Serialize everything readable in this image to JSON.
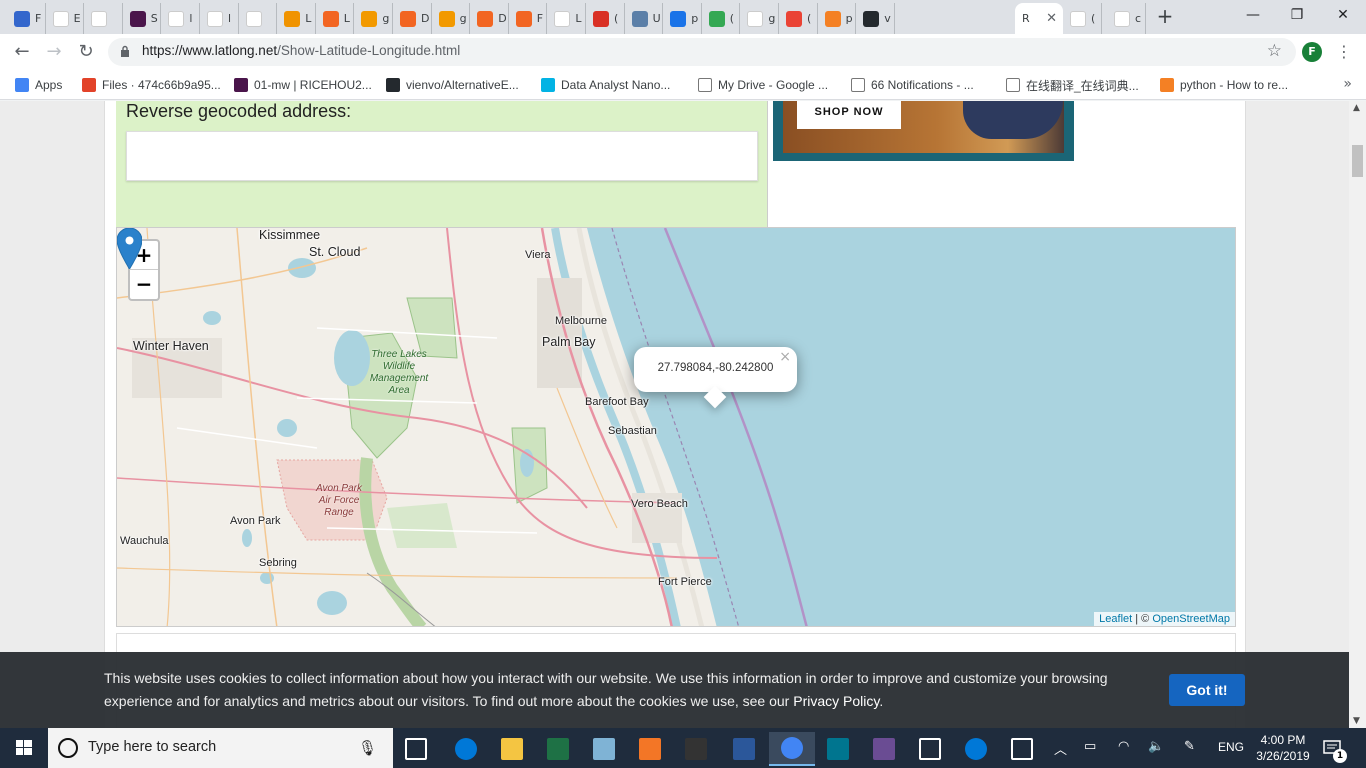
{
  "browser": {
    "tabs": [
      {
        "label": "F",
        "icon": "wikimedia-icon",
        "color": "#3366cc"
      },
      {
        "label": "E",
        "icon": "wikipedia-icon",
        "color": "#ffffff"
      },
      {
        "label": "",
        "icon": "cia-icon",
        "color": "#ffffff"
      },
      {
        "label": "S",
        "icon": "slack-icon",
        "color": "#4a154b"
      },
      {
        "label": "l",
        "icon": "k-icon",
        "color": "#ffffff"
      },
      {
        "label": "l",
        "icon": "k-icon",
        "color": "#ffffff"
      },
      {
        "label": "",
        "icon": "speaker-icon",
        "color": "#ffffff"
      },
      {
        "label": "L",
        "icon": "book-icon",
        "color": "#f09300"
      },
      {
        "label": "L",
        "icon": "circle-orange-icon",
        "color": "#f26522"
      },
      {
        "label": "g",
        "icon": "doc-orange-icon",
        "color": "#f29900"
      },
      {
        "label": "D",
        "icon": "circle-orange-icon",
        "color": "#f26522"
      },
      {
        "label": "g",
        "icon": "doc-orange-icon",
        "color": "#f29900"
      },
      {
        "label": "D",
        "icon": "circle-orange-icon",
        "color": "#f26522"
      },
      {
        "label": "F",
        "icon": "circle-orange-icon",
        "color": "#f26522"
      },
      {
        "label": "L",
        "icon": "wikipedia-icon",
        "color": "#ffffff"
      },
      {
        "label": "(",
        "icon": "gmail-icon",
        "color": "#d93025"
      },
      {
        "label": "U",
        "icon": "grid-icon",
        "color": "#5b7fa8"
      },
      {
        "label": "p",
        "icon": "chart-icon",
        "color": "#1a73e8"
      },
      {
        "label": "(",
        "icon": "maps-icon",
        "color": "#34a853"
      },
      {
        "label": "g",
        "icon": "google-icon",
        "color": "#ffffff"
      },
      {
        "label": "(",
        "icon": "red-square-icon",
        "color": "#ea4335"
      },
      {
        "label": "p",
        "icon": "stackoverflow-icon",
        "color": "#f48024"
      },
      {
        "label": "v",
        "icon": "github-icon",
        "color": "#24292e"
      },
      {
        "label": "R",
        "icon": "none",
        "color": "#ffffff",
        "active": true
      },
      {
        "label": "(",
        "icon": "wikipedia-icon",
        "color": "#ffffff"
      },
      {
        "label": "c",
        "icon": "google-icon",
        "color": "#ffffff"
      }
    ],
    "url_host": "https://www.latlong.net",
    "url_path": "/Show-Latitude-Longitude.html",
    "profile_initial": "F",
    "bookmarks": [
      {
        "label": "Apps",
        "icon": "apps-icon",
        "color": "#4285f4"
      },
      {
        "label": "Files · 474c66b9a95...",
        "icon": "gitlab-icon",
        "color": "#e24329"
      },
      {
        "label": "01-mw | RICEHOU2...",
        "icon": "slack-icon",
        "color": "#4a154b"
      },
      {
        "label": "vienvo/AlternativeE...",
        "icon": "github-icon",
        "color": "#24292e"
      },
      {
        "label": "Data Analyst Nano...",
        "icon": "udacity-icon",
        "color": "#02b3e4"
      },
      {
        "label": "My Drive - Google ...",
        "icon": "page-icon",
        "color": "#ffffff"
      },
      {
        "label": "66 Notifications - ...",
        "icon": "page-icon",
        "color": "#ffffff"
      },
      {
        "label": "在线翻译_在线词典...",
        "icon": "page-icon",
        "color": "#ffffff"
      },
      {
        "label": "python - How to re...",
        "icon": "stackoverflow-icon",
        "color": "#f48024"
      }
    ]
  },
  "page": {
    "reverse_label": "Reverse geocoded address:",
    "reverse_value": "",
    "ad_button": "SHOP NOW"
  },
  "map": {
    "cities": [
      {
        "name": "Kissimmee",
        "big": true
      },
      {
        "name": "St. Cloud",
        "big": true
      },
      {
        "name": "Viera",
        "big": false
      },
      {
        "name": "Melbourne",
        "big": false
      },
      {
        "name": "Palm Bay",
        "big": true
      },
      {
        "name": "Winter Haven",
        "big": true
      },
      {
        "name": "Barefoot Bay",
        "big": false
      },
      {
        "name": "Sebastian",
        "big": false
      },
      {
        "name": "Vero Beach",
        "big": false
      },
      {
        "name": "Avon Park",
        "big": false
      },
      {
        "name": "Wauchula",
        "big": false
      },
      {
        "name": "Sebring",
        "big": false
      },
      {
        "name": "Fort Pierce",
        "big": false
      }
    ],
    "parks": [
      {
        "name": "Three Lakes Wildlife Management Area"
      },
      {
        "name": "Avon Park Air Force Range"
      }
    ],
    "popup_text": "27.798084,-80.242800",
    "zoom_in": "+",
    "zoom_out": "−",
    "attribution_leaflet": "Leaflet",
    "attribution_sep": " | © ",
    "attribution_osm": "OpenStreetMap",
    "colors": {
      "water": "#aad3df",
      "land": "#f2efe9",
      "park": "#c8dfb3",
      "marker": "#2a81cb"
    }
  },
  "cookie": {
    "text": "This website uses cookies to collect information about how you interact with our website. We use this information in order to improve and customize your browsing experience and for analytics and metrics about our visitors. To find out more about the cookies we use, see our ",
    "policy_link": "Privacy Policy",
    "policy_end": ".",
    "button": "Got it!"
  },
  "taskbar": {
    "search_placeholder": "Type here to search",
    "apps": [
      {
        "icon": "task-view-icon",
        "color": "#ffffff"
      },
      {
        "icon": "edge-icon",
        "color": "#0078d7"
      },
      {
        "icon": "file-explorer-icon",
        "color": "#f4c542"
      },
      {
        "icon": "excel-icon",
        "color": "#1e7145"
      },
      {
        "icon": "notepad-icon",
        "color": "#7fb3d5"
      },
      {
        "icon": "jupyter-icon",
        "color": "#f37626"
      },
      {
        "icon": "terminal-icon",
        "color": "#333333"
      },
      {
        "icon": "word-icon",
        "color": "#2b579a"
      },
      {
        "icon": "chrome-icon",
        "color": "#4285f4",
        "active": true
      },
      {
        "icon": "mysql-icon",
        "color": "#00758f"
      },
      {
        "icon": "git-icon",
        "color": "#6a4c93"
      },
      {
        "icon": "photos-icon",
        "color": "#ffffff"
      },
      {
        "icon": "help-icon",
        "color": "#0078d7"
      },
      {
        "icon": "people-icon",
        "color": "#ffffff"
      }
    ],
    "lang": "ENG",
    "time": "4:00 PM",
    "date": "3/26/2019",
    "notifications": "1"
  }
}
